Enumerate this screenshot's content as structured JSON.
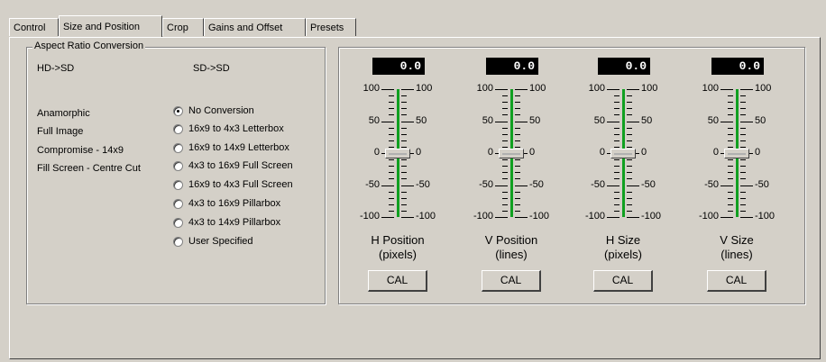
{
  "tabs": [
    "Control",
    "Size and Position",
    "Crop",
    "Gains and Offset",
    "Presets"
  ],
  "active_tab": "Size and Position",
  "aspect": {
    "group_title": "Aspect Ratio Conversion",
    "col_headers": [
      "HD->SD",
      "SD->SD"
    ],
    "hd_labels": [
      "Anamorphic",
      "Full Image",
      "Compromise - 14x9",
      "Fill Screen - Centre Cut"
    ],
    "options": [
      "No Conversion",
      "16x9 to 4x3 Letterbox",
      "16x9 to 14x9 Letterbox",
      "4x3 to 16x9 Full Screen",
      "16x9 to 4x3 Full Screen",
      "4x3 to 16x9 Pillarbox",
      "4x3 to 14x9 Pillarbox",
      "User Specified"
    ],
    "selected": "No Conversion"
  },
  "sliders": [
    {
      "value": "0.0",
      "level": 0,
      "caption_line1": "H Position",
      "caption_line2": "(pixels)",
      "button": "CAL"
    },
    {
      "value": "0.0",
      "level": 0,
      "caption_line1": "V Position",
      "caption_line2": "(lines)",
      "button": "CAL"
    },
    {
      "value": "0.0",
      "level": 0,
      "caption_line1": "H Size",
      "caption_line2": "(pixels)",
      "button": "CAL"
    },
    {
      "value": "0.0",
      "level": 0,
      "caption_line1": "V Size",
      "caption_line2": "(lines)",
      "button": "CAL"
    }
  ],
  "scale_labels": [
    "100",
    "50",
    "0",
    "-50",
    "-100"
  ]
}
